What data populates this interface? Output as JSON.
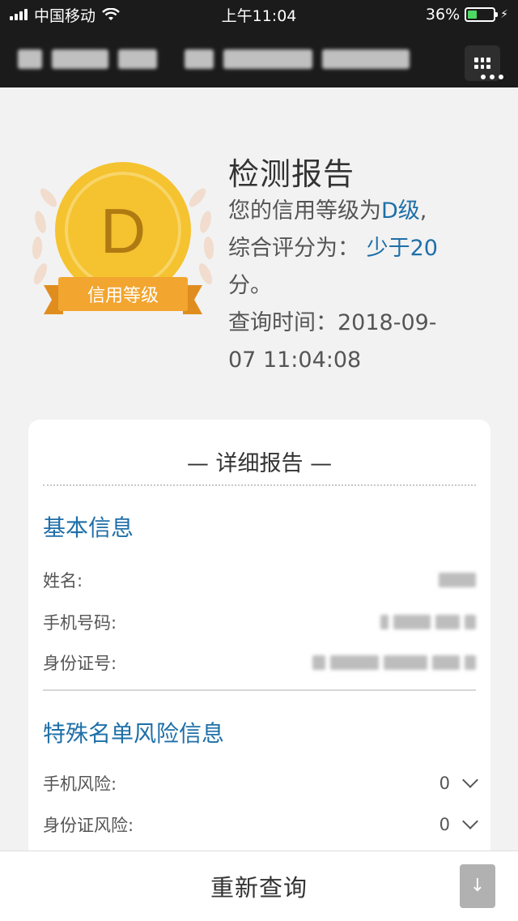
{
  "status_bar": {
    "carrier": "中国移动",
    "time": "上午11:04",
    "battery_percent": "36%",
    "battery_level": 0.36
  },
  "nav": {
    "title_masked": true
  },
  "badge": {
    "grade_letter": "D",
    "ribbon_text": "信用等级",
    "coin_color": "#f5c230",
    "ribbon_color": "#f2a52f"
  },
  "report": {
    "title": "检测报告",
    "line1_prefix": "您的信用等级为",
    "line1_grade": "D级",
    "line1_suffix": ",",
    "line2_prefix": "综合评分为：",
    "line2_score": "少于20",
    "line3": "分。",
    "query_time_label": "查询时间：",
    "query_time_value_a": "2018-09-",
    "query_time_value_b": "07 11:04:08"
  },
  "detail": {
    "heading": "— 详细报告 —",
    "basic_section": "基本信息",
    "fields": [
      {
        "label": "姓名:"
      },
      {
        "label": "手机号码:"
      },
      {
        "label": "身份证号:"
      }
    ],
    "risk_section": "特殊名单风险信息",
    "risks": [
      {
        "label": "手机风险:",
        "value": "0"
      },
      {
        "label": "身份证风险:",
        "value": "0"
      }
    ]
  },
  "bottom": {
    "requery_label": "重新查询",
    "download_icon": "download-icon"
  },
  "colors": {
    "accent_blue": "#1e6fa8",
    "bar_dark": "#1b1b1b",
    "page_bg": "#f2f2f2"
  }
}
